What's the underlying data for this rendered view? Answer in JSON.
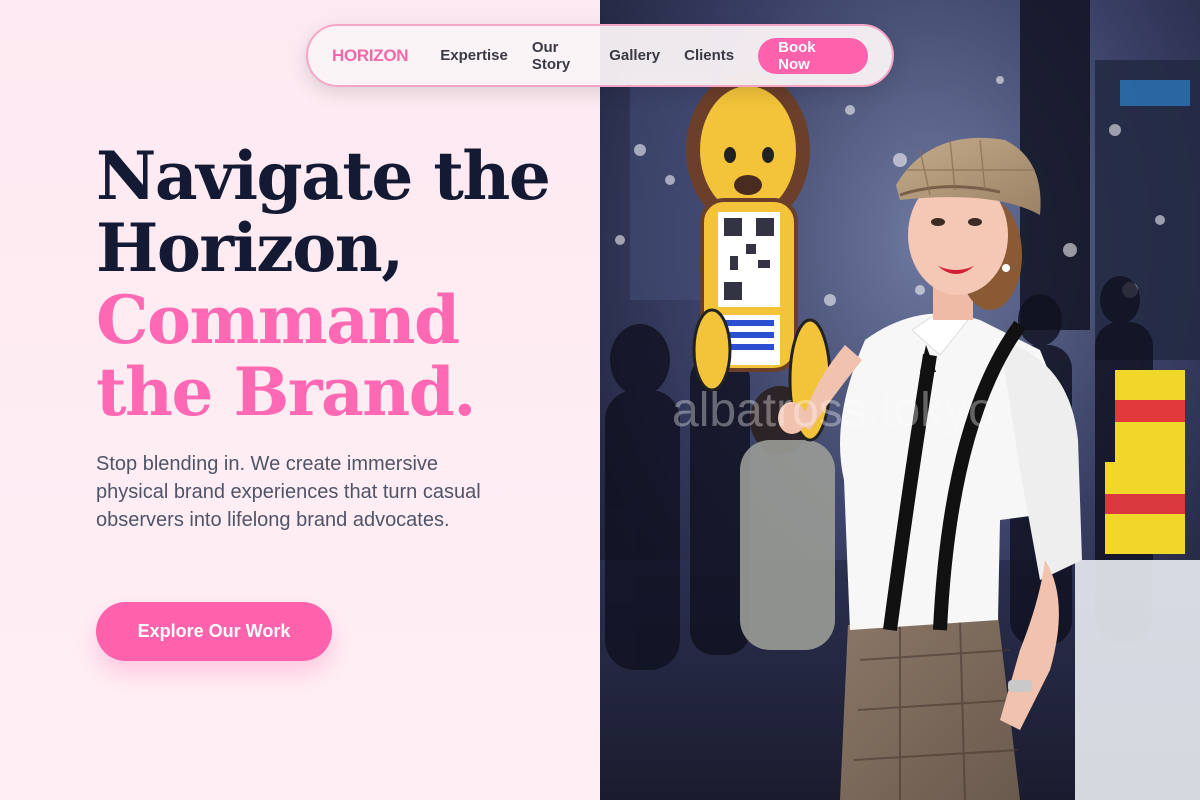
{
  "nav": {
    "logo": "HORIZON",
    "links": [
      "Expertise",
      "Our Story",
      "Gallery",
      "Clients"
    ],
    "cta": "Book Now"
  },
  "hero": {
    "title_line1": "Navigate the",
    "title_line2": "Horizon,",
    "title_line3": "Command",
    "title_line4": "the Brand.",
    "subtitle": "Stop blending in. We create immersive physical brand experiences that turn casual observers into lifelong brand advocates.",
    "cta": "Explore Our Work"
  },
  "image": {
    "watermark": "albatross.tokyo"
  },
  "colors": {
    "accent": "#ff62ac",
    "heading_dark": "#141a33",
    "background": "#fdeef4"
  }
}
